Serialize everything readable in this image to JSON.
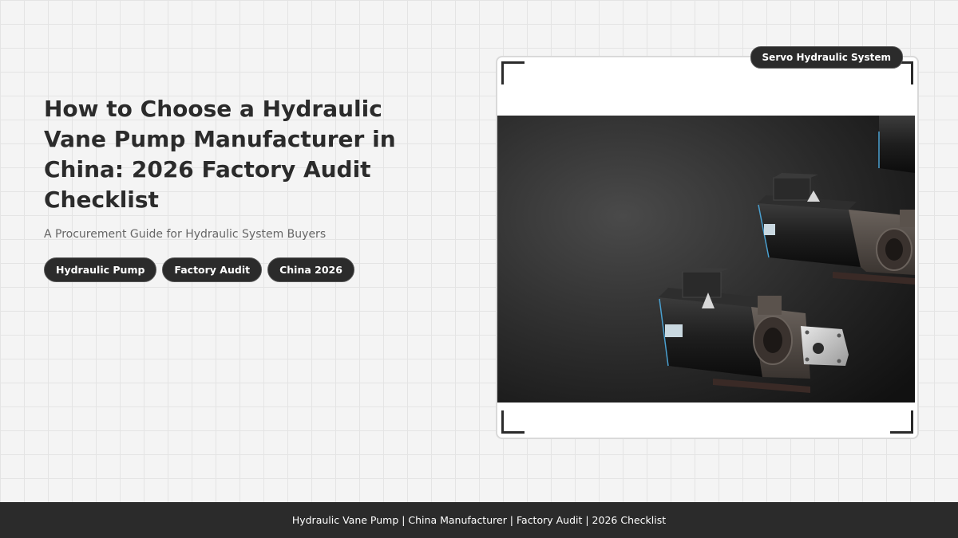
{
  "hero": {
    "title": "How to Choose a Hydraulic Vane Pump Manufacturer in China: 2026 Factory Audit Checklist",
    "subtitle": "A Procurement Guide for Hydraulic System Buyers",
    "tags": [
      "Hydraulic Pump",
      "Factory Audit",
      "China 2026"
    ]
  },
  "image_card": {
    "badge": "Servo Hydraulic System",
    "image_subject": "servo-motor-hydraulic-pump-units"
  },
  "footer": {
    "text": "Hydraulic Vane Pump | China Manufacturer | Factory Audit | 2026 Checklist"
  },
  "colors": {
    "background": "#f4f4f4",
    "grid": "#e4e4e4",
    "text": "#2b2b2b",
    "subtitle": "#666666",
    "pill": "#2b2b2b",
    "footer": "#2b2b2b"
  }
}
